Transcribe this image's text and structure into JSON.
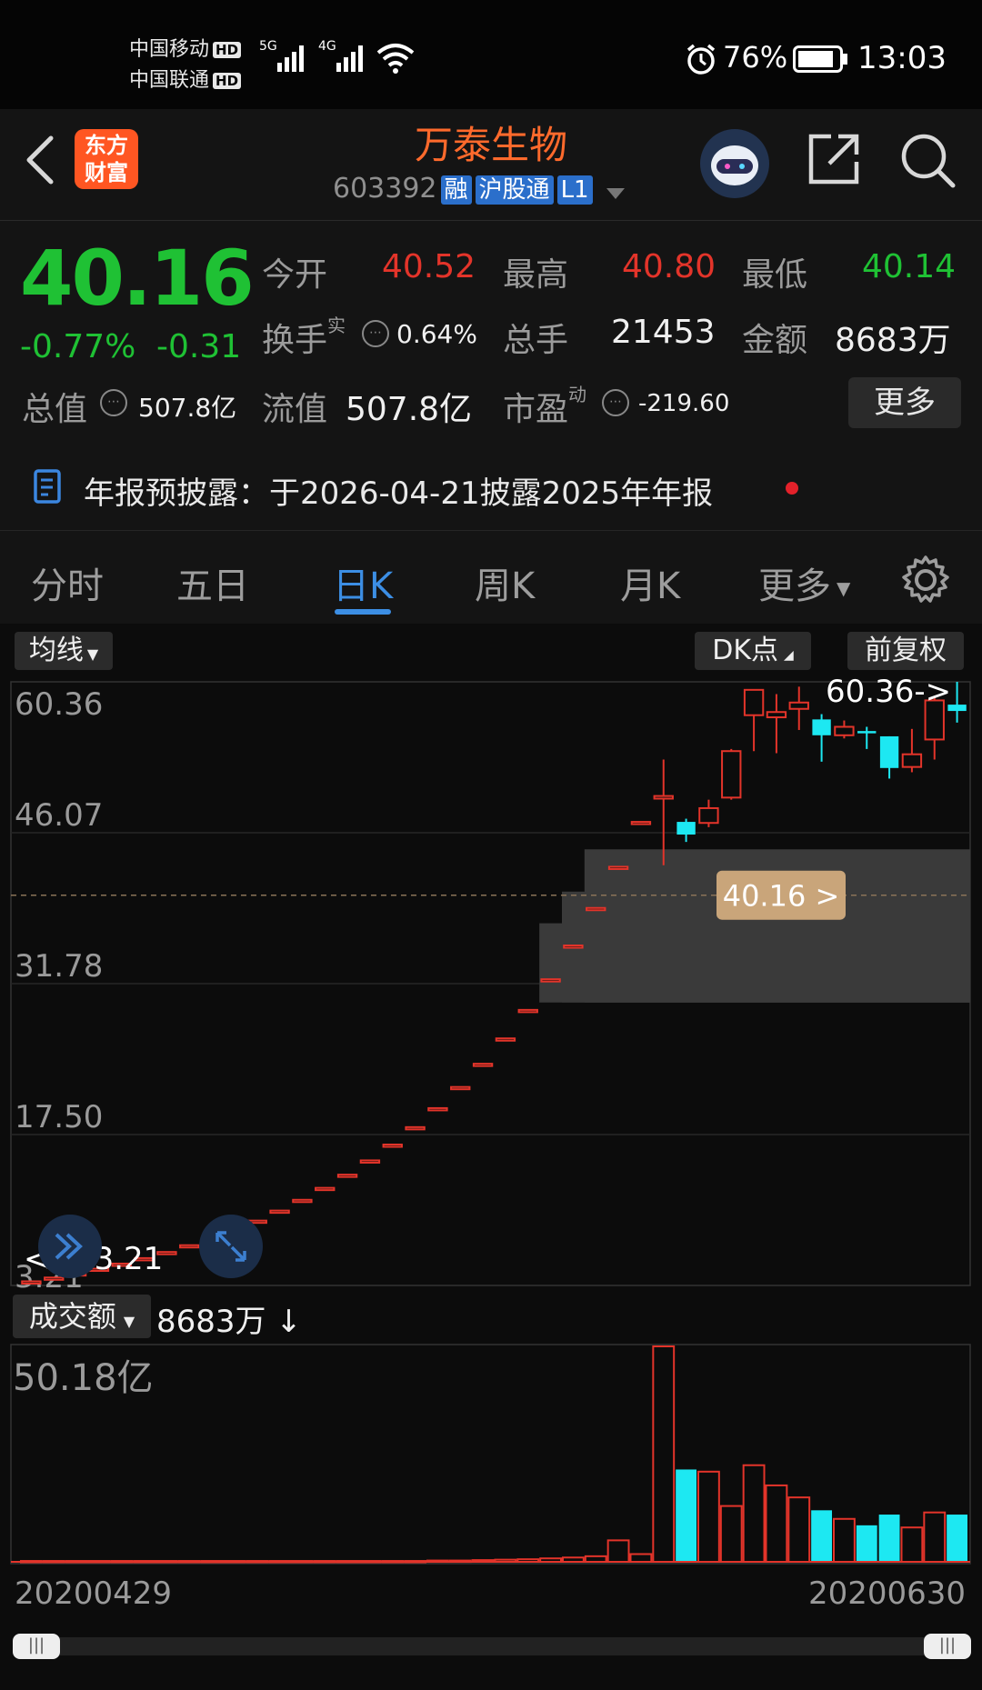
{
  "status_bar": {
    "carrier1": "中国移动",
    "carrier2": "中国联通",
    "hd": "HD",
    "net1": "5G",
    "net2": "4G",
    "battery": "76%",
    "time": "13:03"
  },
  "header": {
    "logo_line1": "东方",
    "logo_line2": "财富",
    "title": "万泰生物",
    "code": "603392",
    "tags": [
      "融",
      "沪股通",
      "L1"
    ]
  },
  "quote": {
    "price": "40.16",
    "change_pct": "-0.77%",
    "change": "-0.31",
    "open_label": "今开",
    "open": "40.52",
    "high_label": "最高",
    "high": "40.80",
    "low_label": "最低",
    "low": "40.14",
    "turnover_label": "换手",
    "turnover_sup": "实",
    "turnover": "0.64%",
    "volume_label": "总手",
    "volume": "21453",
    "amount_label": "金额",
    "amount": "8683万",
    "mktcap_label": "总值",
    "mktcap": "507.8亿",
    "float_label": "流值",
    "float_cap": "507.8亿",
    "pe_label": "市盈",
    "pe_sup": "动",
    "pe": "-219.60",
    "more_button": "更多",
    "notice": "年报预披露：于2026-04-21披露2025年年报"
  },
  "tabs": [
    "分时",
    "五日",
    "日K",
    "周K",
    "月K",
    "更多"
  ],
  "active_tab": "日K",
  "chart_controls": {
    "ma_button": "均线",
    "dk_button": "DK点",
    "adjust_button": "前复权",
    "vol_select": "成交额",
    "vol_value": "8683万",
    "vol_arrow": "↓"
  },
  "chart_data": {
    "type": "candlestick",
    "y_ticks": [
      "60.36",
      "46.07",
      "31.78",
      "17.50",
      "3.21"
    ],
    "ylim": [
      3.21,
      60.36
    ],
    "max_marker": "60.36->",
    "min_marker": "<----3.21",
    "current_price_label": "40.16 >",
    "current_price": 40.16,
    "x_start": "20200429",
    "x_end": "20200630",
    "volume_top_label": "50.18亿",
    "volume_max": 50.18,
    "candles": [
      {
        "o": 3.4,
        "c": 3.6,
        "h": 3.6,
        "l": 3.4,
        "v": 0.2
      },
      {
        "o": 3.9,
        "c": 3.96,
        "h": 3.96,
        "l": 3.9,
        "v": 0.2
      },
      {
        "o": 4.3,
        "c": 4.36,
        "h": 4.36,
        "l": 4.3,
        "v": 0.2
      },
      {
        "o": 4.75,
        "c": 4.8,
        "h": 4.8,
        "l": 4.75,
        "v": 0.2
      },
      {
        "o": 5.2,
        "c": 5.28,
        "h": 5.28,
        "l": 5.2,
        "v": 0.2
      },
      {
        "o": 5.75,
        "c": 5.8,
        "h": 5.8,
        "l": 5.75,
        "v": 0.2
      },
      {
        "o": 6.3,
        "c": 6.38,
        "h": 6.38,
        "l": 6.3,
        "v": 0.2
      },
      {
        "o": 6.95,
        "c": 7.02,
        "h": 7.02,
        "l": 6.95,
        "v": 0.2
      },
      {
        "o": 7.65,
        "c": 7.72,
        "h": 7.72,
        "l": 7.65,
        "v": 0.2
      },
      {
        "o": 8.4,
        "c": 8.5,
        "h": 8.5,
        "l": 8.4,
        "v": 0.2
      },
      {
        "o": 9.25,
        "c": 9.35,
        "h": 9.35,
        "l": 9.25,
        "v": 0.2
      },
      {
        "o": 10.2,
        "c": 10.3,
        "h": 10.3,
        "l": 10.2,
        "v": 0.2
      },
      {
        "o": 11.2,
        "c": 11.32,
        "h": 11.32,
        "l": 11.2,
        "v": 0.2
      },
      {
        "o": 12.35,
        "c": 12.45,
        "h": 12.45,
        "l": 12.35,
        "v": 0.2
      },
      {
        "o": 13.55,
        "c": 13.7,
        "h": 13.7,
        "l": 13.55,
        "v": 0.2
      },
      {
        "o": 14.9,
        "c": 15.05,
        "h": 15.05,
        "l": 14.9,
        "v": 0.2
      },
      {
        "o": 16.4,
        "c": 16.55,
        "h": 16.55,
        "l": 16.4,
        "v": 0.2
      },
      {
        "o": 18.05,
        "c": 18.2,
        "h": 18.2,
        "l": 18.05,
        "v": 0.2
      },
      {
        "o": 19.85,
        "c": 20.0,
        "h": 20.0,
        "l": 19.85,
        "v": 0.3
      },
      {
        "o": 21.85,
        "c": 22.0,
        "h": 22.0,
        "l": 21.85,
        "v": 0.3
      },
      {
        "o": 24.05,
        "c": 24.2,
        "h": 24.2,
        "l": 24.05,
        "v": 0.4
      },
      {
        "o": 26.4,
        "c": 26.6,
        "h": 26.6,
        "l": 26.4,
        "v": 0.5
      },
      {
        "o": 29.1,
        "c": 29.3,
        "h": 29.3,
        "l": 29.1,
        "v": 0.6
      },
      {
        "o": 32.0,
        "c": 32.2,
        "h": 32.2,
        "l": 32.0,
        "v": 0.8
      },
      {
        "o": 35.2,
        "c": 35.4,
        "h": 35.4,
        "l": 35.2,
        "v": 1.0
      },
      {
        "o": 38.8,
        "c": 38.95,
        "h": 38.95,
        "l": 38.8,
        "v": 1.3
      },
      {
        "o": 42.7,
        "c": 42.85,
        "h": 42.85,
        "l": 42.7,
        "v": 5.0
      },
      {
        "o": 46.9,
        "c": 47.1,
        "h": 47.1,
        "l": 46.9,
        "v": 1.8
      },
      {
        "o": 49.3,
        "c": 49.55,
        "h": 53.0,
        "l": 43.0,
        "v": 50.18
      },
      {
        "o": 47.1,
        "c": 45.9,
        "h": 47.4,
        "l": 45.2,
        "v": 21.5
      },
      {
        "o": 47.0,
        "c": 48.4,
        "h": 49.2,
        "l": 46.6,
        "v": 21.0
      },
      {
        "o": 49.4,
        "c": 53.8,
        "h": 54.0,
        "l": 49.2,
        "v": 13.0
      },
      {
        "o": 57.2,
        "c": 59.6,
        "h": 59.6,
        "l": 53.8,
        "v": 22.5
      },
      {
        "o": 57.0,
        "c": 57.5,
        "h": 59.2,
        "l": 53.6,
        "v": 17.8
      },
      {
        "o": 57.8,
        "c": 58.4,
        "h": 59.9,
        "l": 55.8,
        "v": 15.0
      },
      {
        "o": 56.8,
        "c": 55.3,
        "h": 57.3,
        "l": 52.8,
        "v": 12.0
      },
      {
        "o": 55.3,
        "c": 56.1,
        "h": 56.7,
        "l": 55.0,
        "v": 10.0
      },
      {
        "o": 55.7,
        "c": 55.6,
        "h": 56.1,
        "l": 54.0,
        "v": 8.5
      },
      {
        "o": 55.2,
        "c": 52.2,
        "h": 55.2,
        "l": 51.2,
        "v": 11.0
      },
      {
        "o": 52.3,
        "c": 53.5,
        "h": 55.9,
        "l": 51.8,
        "v": 8.0
      },
      {
        "o": 54.9,
        "c": 58.6,
        "h": 58.9,
        "l": 53.0,
        "v": 11.5
      },
      {
        "o": 58.2,
        "c": 57.6,
        "h": 60.36,
        "l": 56.5,
        "v": 11.0
      }
    ]
  }
}
